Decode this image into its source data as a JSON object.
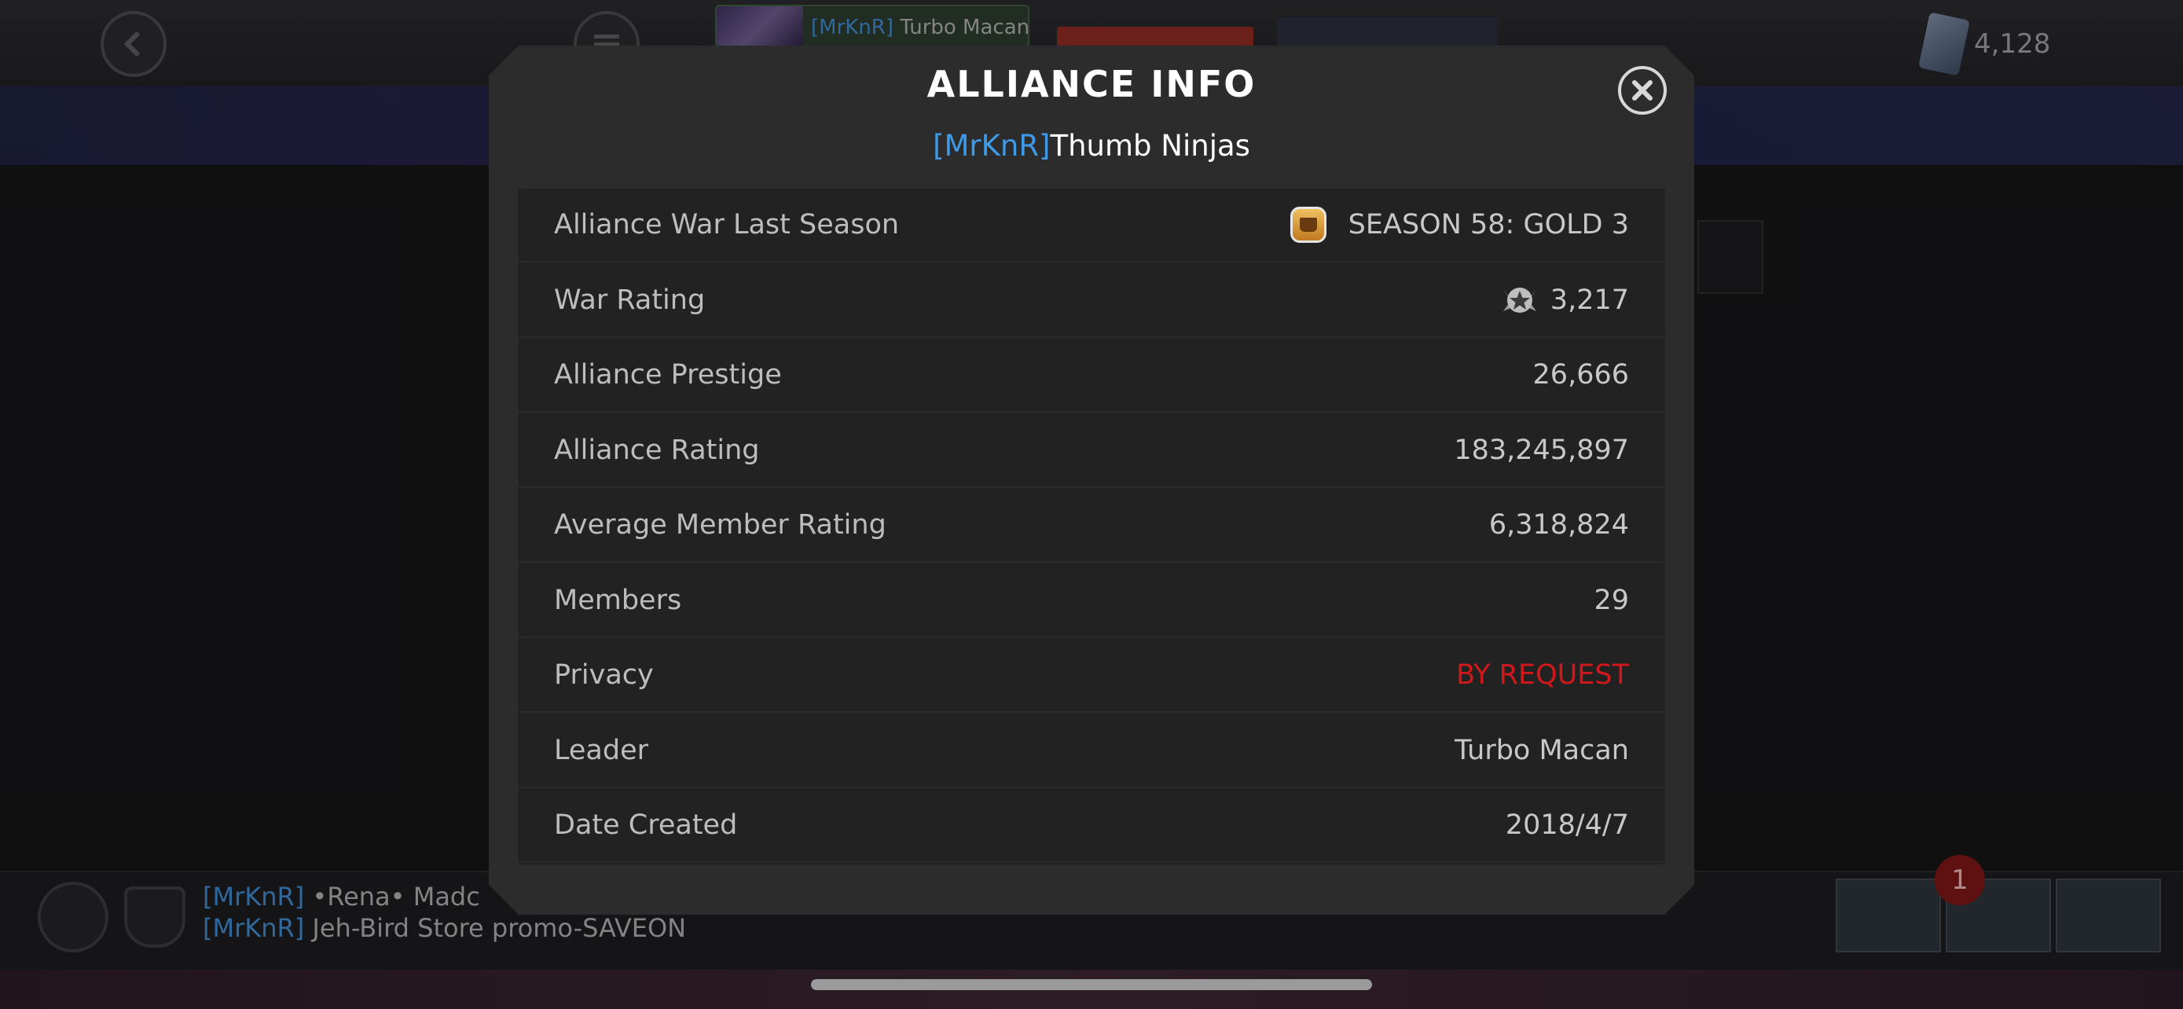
{
  "background": {
    "chip_tag": "[MrKnR]",
    "chip_name": "Turbo Macan",
    "currency_value": "4,128",
    "chat": [
      {
        "tag": "[MrKnR]",
        "text": "•Rena•  Madc"
      },
      {
        "tag": "[MrKnR]",
        "text": "Jeh-Bird  Store promo-SAVEON"
      }
    ],
    "notification_count": "1"
  },
  "modal": {
    "title": "ALLIANCE INFO",
    "alliance_tag": "[MrKnR]",
    "alliance_name": "Thumb Ninjas",
    "rows": [
      {
        "label": "Alliance War Last Season",
        "value": "SEASON 58: GOLD 3"
      },
      {
        "label": "War Rating",
        "value": "3,217"
      },
      {
        "label": "Alliance Prestige",
        "value": "26,666"
      },
      {
        "label": "Alliance Rating",
        "value": "183,245,897"
      },
      {
        "label": "Average Member Rating",
        "value": "6,318,824"
      },
      {
        "label": "Members",
        "value": "29"
      },
      {
        "label": "Privacy",
        "value": "BY REQUEST"
      },
      {
        "label": "Leader",
        "value": "Turbo Macan"
      },
      {
        "label": "Date Created",
        "value": "2018/4/7"
      }
    ]
  },
  "colors": {
    "tag_blue": "#3e9ae6",
    "privacy_red": "#d2181b",
    "modal_bg": "#2c2c2c"
  },
  "icons": [
    "back-arrow-icon",
    "menu-icon",
    "close-icon",
    "gold-tier-badge-icon",
    "war-rating-star-icon",
    "alliance-members-icon",
    "alliance-shield-icon",
    "units-crystal-icon"
  ]
}
